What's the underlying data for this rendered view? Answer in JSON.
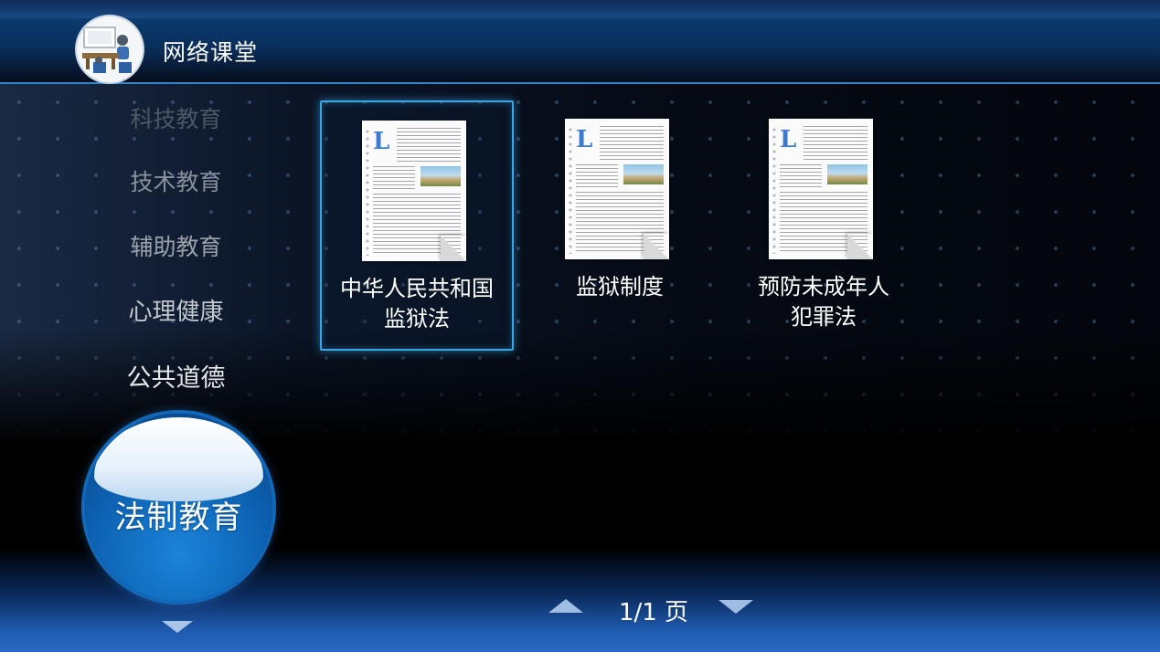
{
  "app": {
    "title": "网络课堂"
  },
  "sidebar": {
    "items": [
      {
        "label": "科技教育"
      },
      {
        "label": "技术教育"
      },
      {
        "label": "辅助教育"
      },
      {
        "label": "心理健康"
      },
      {
        "label": "公共道德"
      }
    ],
    "selected_label": "法制教育"
  },
  "content": {
    "items": [
      {
        "title": "中华人民共和国监狱法",
        "line1": "中华人民共和国",
        "line2": "监狱法",
        "selected": true
      },
      {
        "title": "监狱制度",
        "line1": "监狱制度",
        "line2": "",
        "selected": false
      },
      {
        "title": "预防未成年人犯罪法",
        "line1": "预防未成年人",
        "line2": "犯罪法",
        "selected": false
      }
    ]
  },
  "pagination": {
    "text": "1/1 页"
  },
  "colors": {
    "accent": "#3aa7e6",
    "header_line": "#2f86c8",
    "circle_blue": "#0c5fb0"
  },
  "icons": {
    "logo": "classroom-icon",
    "document": "document-icon",
    "up": "arrow-up-icon",
    "down": "arrow-down-icon"
  }
}
